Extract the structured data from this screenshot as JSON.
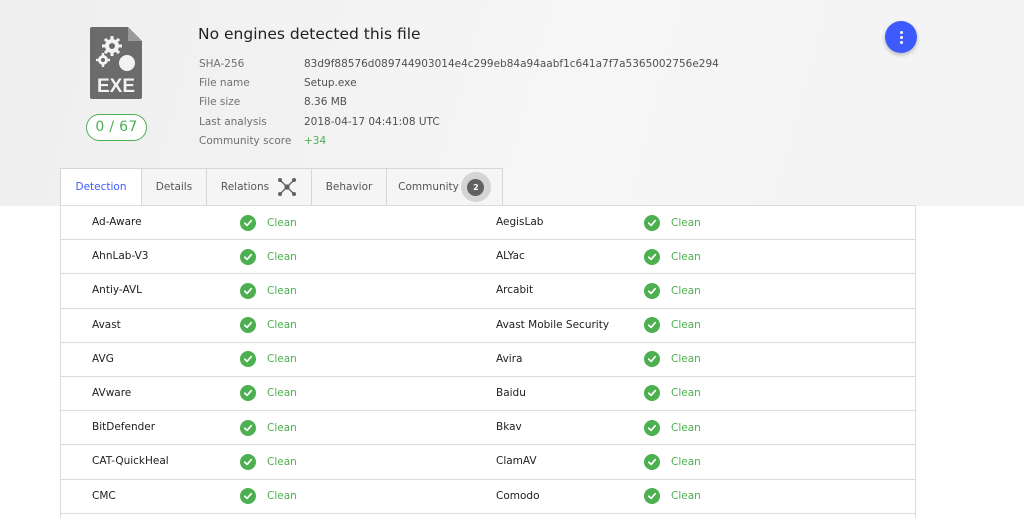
{
  "file": {
    "type_label": "EXE",
    "score": "0 / 67",
    "title": "No engines detected this file"
  },
  "details": [
    {
      "label": "SHA-256",
      "value": "83d9f88576d089744903014e4c299eb84a94aabf1c641a7f7a5365002756e294"
    },
    {
      "label": "File name",
      "value": "Setup.exe"
    },
    {
      "label": "File size",
      "value": "8.36 MB"
    },
    {
      "label": "Last analysis",
      "value": "2018-04-17 04:41:08 UTC"
    },
    {
      "label": "Community score",
      "value": "+34"
    }
  ],
  "tabs": [
    {
      "label": "Detection"
    },
    {
      "label": "Details"
    },
    {
      "label": "Relations",
      "icon": "graph-icon"
    },
    {
      "label": "Behavior"
    },
    {
      "label": "Community",
      "badge": "2"
    }
  ],
  "colors": {
    "accent": "#3d5afe",
    "clean": "#4caf50"
  },
  "results": [
    {
      "left": {
        "engine": "Ad-Aware",
        "status": "Clean"
      },
      "right": {
        "engine": "AegisLab",
        "status": "Clean"
      }
    },
    {
      "left": {
        "engine": "AhnLab-V3",
        "status": "Clean"
      },
      "right": {
        "engine": "ALYac",
        "status": "Clean"
      }
    },
    {
      "left": {
        "engine": "Antiy-AVL",
        "status": "Clean"
      },
      "right": {
        "engine": "Arcabit",
        "status": "Clean"
      }
    },
    {
      "left": {
        "engine": "Avast",
        "status": "Clean"
      },
      "right": {
        "engine": "Avast Mobile Security",
        "status": "Clean"
      }
    },
    {
      "left": {
        "engine": "AVG",
        "status": "Clean"
      },
      "right": {
        "engine": "Avira",
        "status": "Clean"
      }
    },
    {
      "left": {
        "engine": "AVware",
        "status": "Clean"
      },
      "right": {
        "engine": "Baidu",
        "status": "Clean"
      }
    },
    {
      "left": {
        "engine": "BitDefender",
        "status": "Clean"
      },
      "right": {
        "engine": "Bkav",
        "status": "Clean"
      }
    },
    {
      "left": {
        "engine": "CAT-QuickHeal",
        "status": "Clean"
      },
      "right": {
        "engine": "ClamAV",
        "status": "Clean"
      }
    },
    {
      "left": {
        "engine": "CMC",
        "status": "Clean"
      },
      "right": {
        "engine": "Comodo",
        "status": "Clean"
      }
    }
  ]
}
